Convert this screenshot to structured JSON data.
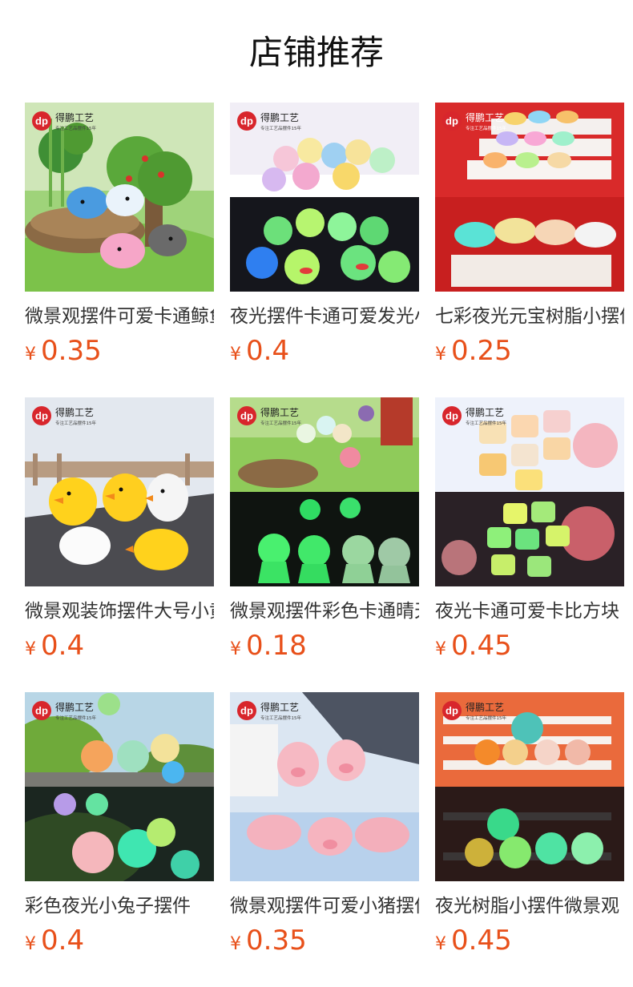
{
  "page": {
    "title": "店铺推荐"
  },
  "brand": {
    "logo_mark": "dp",
    "logo_text": "得鹏工艺",
    "logo_sub": "专注工艺品摆件15年",
    "accent": "#e8501a"
  },
  "products": [
    {
      "name": "微景观摆件可爱卡通鲸鱼",
      "currency": "¥",
      "price": "0.35",
      "image": "resin-whales-in-garden",
      "theme": "garden"
    },
    {
      "name": "夜光摆件卡通可爱发光小鸭",
      "currency": "¥",
      "price": "0.4",
      "image": "crowned-ducks-glow",
      "theme": "split-stage"
    },
    {
      "name": "七彩夜光元宝树脂小摆件",
      "currency": "¥",
      "price": "0.25",
      "image": "rainbow-ingots-on-steps",
      "theme": "red-split"
    },
    {
      "name": "微景观装饰摆件大号小黄鸭",
      "currency": "¥",
      "price": "0.4",
      "image": "yellow-ducks-on-rock",
      "theme": "rock"
    },
    {
      "name": "微景观摆件彩色卡通晴天娃娃",
      "currency": "¥",
      "price": "0.18",
      "image": "sunny-dolls-glow",
      "theme": "garden-split"
    },
    {
      "name": "夜光卡通可爱卡比方块",
      "currency": "¥",
      "price": "0.45",
      "image": "cartoon-cubes-glow",
      "theme": "pastel-split"
    },
    {
      "name": "彩色夜光小兔子摆件",
      "currency": "¥",
      "price": "0.4",
      "image": "glow-bunnies-on-moss",
      "theme": "moss-split"
    },
    {
      "name": "微景观摆件可爱小猪摆件",
      "currency": "¥",
      "price": "0.35",
      "image": "pink-pigs",
      "theme": "blue"
    },
    {
      "name": "夜光树脂小摆件微景观",
      "currency": "¥",
      "price": "0.45",
      "image": "glow-animals-on-bench",
      "theme": "bench-split"
    }
  ]
}
